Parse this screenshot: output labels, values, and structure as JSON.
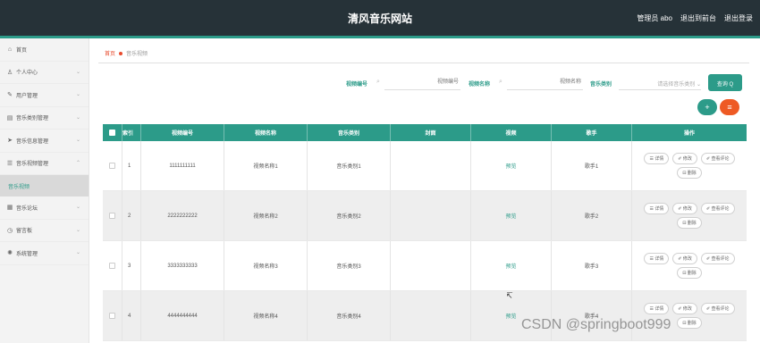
{
  "header": {
    "title": "清风音乐网站",
    "admin": "管理员 abo",
    "back_to_console": "退出到前台",
    "logout": "退出登录"
  },
  "sidebar": {
    "items": [
      {
        "label": "首页",
        "icon": "home-icon",
        "glyph": "⌂",
        "has_chevron": false
      },
      {
        "label": "个人中心",
        "icon": "user-icon",
        "glyph": "♙",
        "has_chevron": true
      },
      {
        "label": "用户管理",
        "icon": "pen-icon",
        "glyph": "✎",
        "has_chevron": true
      },
      {
        "label": "音乐类别管理",
        "icon": "grid-icon",
        "glyph": "▤",
        "has_chevron": true
      },
      {
        "label": "音乐信息管理",
        "icon": "send-icon",
        "glyph": "➤",
        "has_chevron": true
      },
      {
        "label": "音乐视频管理",
        "icon": "doc-icon",
        "glyph": "☰",
        "has_chevron": true,
        "expanded": true
      }
    ],
    "sub_active": "音乐视频",
    "items_after": [
      {
        "label": "音乐论坛",
        "icon": "forum-icon",
        "glyph": "▦",
        "has_chevron": true
      },
      {
        "label": "留言板",
        "icon": "clock-icon",
        "glyph": "◷",
        "has_chevron": true
      },
      {
        "label": "系统管理",
        "icon": "settings-icon",
        "glyph": "✺",
        "has_chevron": true
      }
    ]
  },
  "breadcrumb": {
    "home": "首页",
    "current": "音乐视频"
  },
  "search": {
    "label_code": "视频编号",
    "placeholder_code": "视频编号",
    "label_name": "视频名称",
    "placeholder_name": "视频名称",
    "label_category": "音乐类别",
    "select_placeholder": "请选择音乐类别",
    "query_button": "查询 Q"
  },
  "actions": {
    "add": "+",
    "delete": "≡"
  },
  "table": {
    "headers": [
      "索引",
      "视频编号",
      "视频名称",
      "音乐类别",
      "封面",
      "视频",
      "歌手",
      "操作"
    ],
    "rows": [
      {
        "index": "1",
        "code": "1111111111",
        "name": "视频名称1",
        "category": "音乐类别1",
        "video": "预览",
        "singer": "歌手1"
      },
      {
        "index": "2",
        "code": "2222222222",
        "name": "视频名称2",
        "category": "音乐类别2",
        "video": "预览",
        "singer": "歌手2"
      },
      {
        "index": "3",
        "code": "3333333333",
        "name": "视频名称3",
        "category": "音乐类别3",
        "video": "预览",
        "singer": "歌手3"
      },
      {
        "index": "4",
        "code": "4444444444",
        "name": "视频名称4",
        "category": "音乐类别4",
        "video": "预览",
        "singer": "歌手4"
      }
    ],
    "op_labels": {
      "detail": "☰ 详情",
      "edit": "✐ 修改",
      "comments": "✐ 查看评论",
      "delete": "⊟ 删除"
    }
  },
  "watermark": "CSDN @springboot999",
  "colors": {
    "topbar": "#263238",
    "accent": "#2c9b89",
    "danger": "#ee5a24"
  }
}
